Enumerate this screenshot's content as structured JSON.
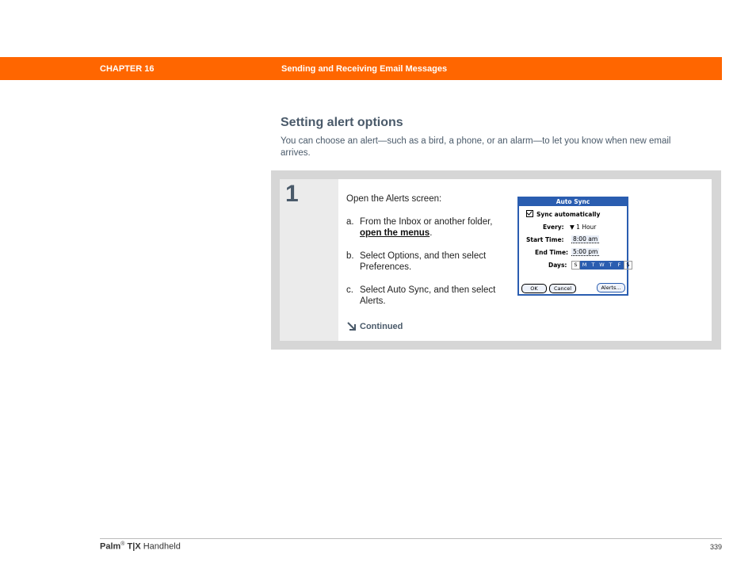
{
  "header": {
    "chapter": "CHAPTER 16",
    "title": "Sending and Receiving Email Messages"
  },
  "section": {
    "title": "Setting alert options",
    "intro": "You can choose an alert—such as a bird, a phone, or an alarm—to let you know when new email arrives."
  },
  "step": {
    "number": "1",
    "lead": "Open the Alerts screen:",
    "items": [
      {
        "marker": "a.",
        "text_before": "From the Inbox or another folder, ",
        "link": "open the menus",
        "text_after": "."
      },
      {
        "marker": "b.",
        "text": "Select Options, and then select Preferences."
      },
      {
        "marker": "c.",
        "text": "Select Auto Sync, and then select Alerts."
      }
    ],
    "continued": "Continued"
  },
  "palm_screen": {
    "title": "Auto Sync",
    "sync_checkbox": "Sync automatically",
    "every_label": "Every:",
    "every_value": "1 Hour",
    "start_label": "Start Time:",
    "start_value": "8:00 am",
    "end_label": "End Time:",
    "end_value": "5:00 pm",
    "days_label": "Days:",
    "days": [
      "S",
      "M",
      "T",
      "W",
      "T",
      "F",
      "S"
    ],
    "days_selected": [
      false,
      true,
      true,
      true,
      true,
      true,
      false
    ],
    "buttons": {
      "ok": "OK",
      "cancel": "Cancel",
      "alerts": "Alerts..."
    },
    "accent_color": "#2a5db0"
  },
  "footer": {
    "brand": "Palm",
    "reg": "®",
    "model": "T|X",
    "product": "Handheld",
    "page": "339"
  },
  "colors": {
    "chapter_bar": "#ff6600",
    "heading": "#4a5a6a"
  }
}
